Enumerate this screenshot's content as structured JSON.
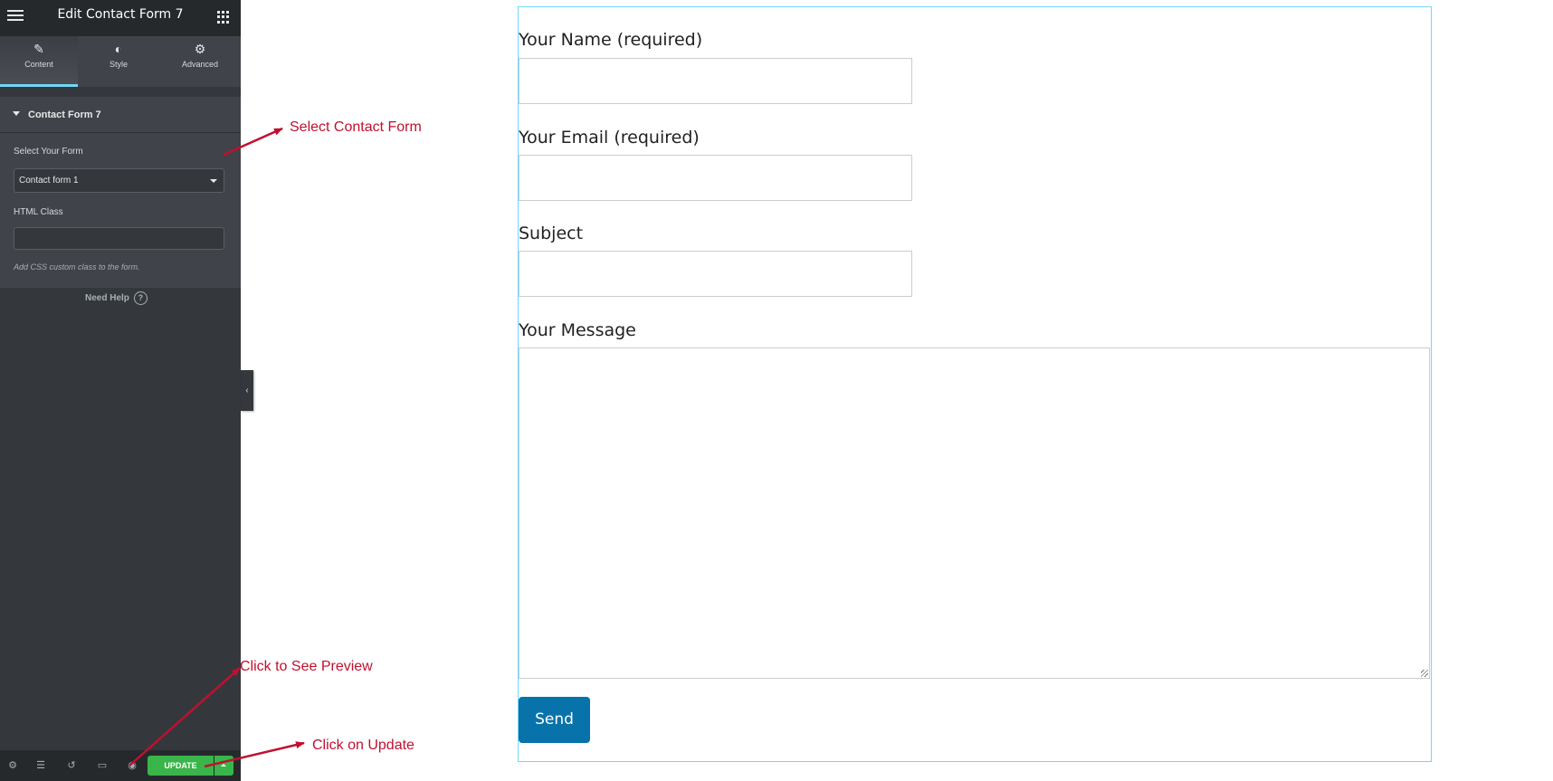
{
  "sidebar": {
    "header": {
      "title": "Edit Contact Form 7",
      "menu_icon": "hamburger-icon",
      "apps_icon": "grid-icon"
    },
    "tabs": [
      {
        "label": "Content",
        "icon": "pencil-icon",
        "active": true
      },
      {
        "label": "Style",
        "icon": "half-circle-icon",
        "active": false
      },
      {
        "label": "Advanced",
        "icon": "gear-icon",
        "active": false
      }
    ],
    "section": {
      "title": "Contact Form 7",
      "select_label": "Select Your Form",
      "select_value": "Contact form 1",
      "html_class_label": "HTML Class",
      "html_class_value": "",
      "help_text": "Add CSS custom class to the form."
    },
    "need_help": "Need Help",
    "bottom_bar": {
      "icons": [
        "gear-icon",
        "layers-icon",
        "history-icon",
        "desktop-icon",
        "eye-icon"
      ],
      "update_label": "UPDATE"
    },
    "accent_color": "#71d7f7",
    "update_color": "#39b54a"
  },
  "form": {
    "fields": [
      {
        "label": "Your Name (required)",
        "value": ""
      },
      {
        "label": "Your Email (required)",
        "value": ""
      },
      {
        "label": "Subject",
        "value": ""
      }
    ],
    "message_label": "Your Message",
    "message_value": "",
    "send_label": "Send",
    "send_color": "#0873aa"
  },
  "annotations": {
    "select_form": "Select Contact Form",
    "preview": "Click to See Preview",
    "update": "Click on Update",
    "color": "#c0102f"
  }
}
